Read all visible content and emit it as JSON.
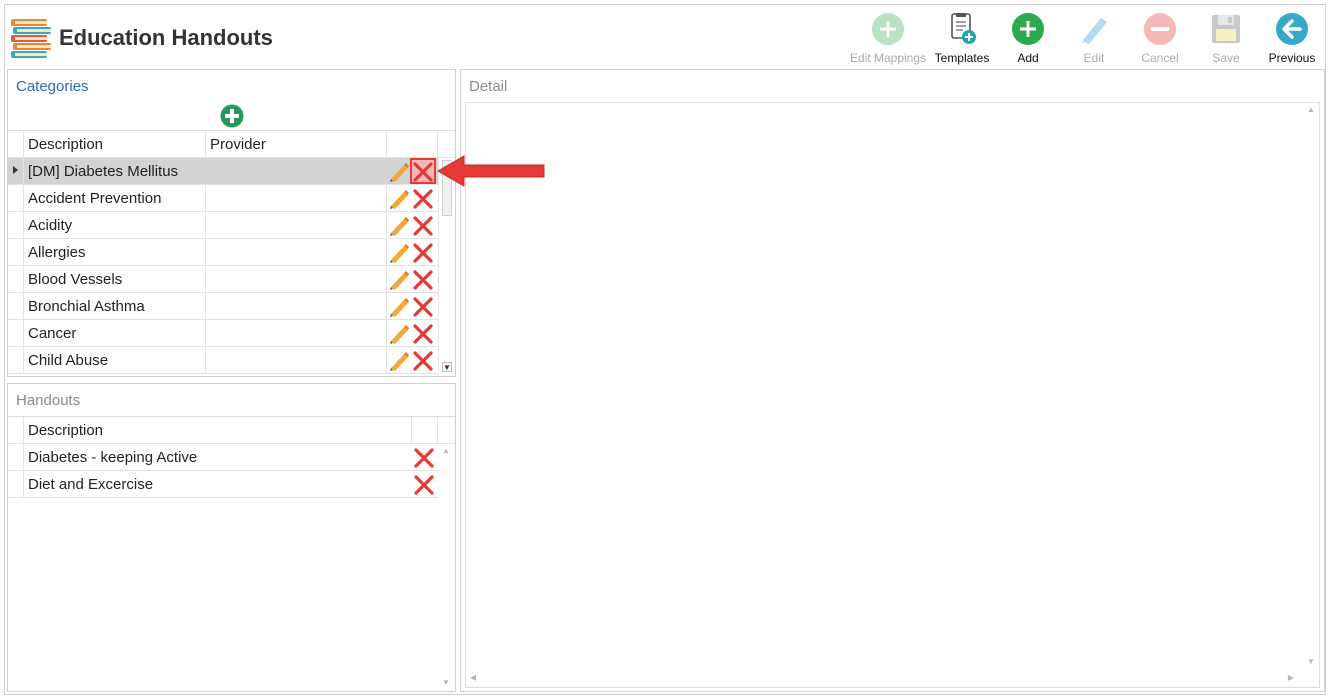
{
  "app": {
    "title": "Education Handouts",
    "logo_icon": "books-icon"
  },
  "toolbar": {
    "buttons": [
      {
        "label": "Edit Mappings",
        "icon": "plus-circle-icon",
        "enabled": false
      },
      {
        "label": "Templates",
        "icon": "document-add-icon",
        "enabled": true
      },
      {
        "label": "Add",
        "icon": "plus-circle-icon",
        "enabled": true
      },
      {
        "label": "Edit",
        "icon": "pencil-icon",
        "enabled": false
      },
      {
        "label": "Cancel",
        "icon": "minus-circle-icon",
        "enabled": false
      },
      {
        "label": "Save",
        "icon": "floppy-disk-icon",
        "enabled": false
      },
      {
        "label": "Previous",
        "icon": "arrow-left-circle-icon",
        "enabled": true
      }
    ]
  },
  "categories": {
    "title": "Categories",
    "add_icon": "add-category-icon",
    "columns": [
      "Description",
      "Provider"
    ],
    "rows": [
      {
        "description": "[DM] Diabetes Mellitus",
        "provider": "",
        "selected": true
      },
      {
        "description": "Accident Prevention",
        "provider": "",
        "selected": false
      },
      {
        "description": "Acidity",
        "provider": "",
        "selected": false
      },
      {
        "description": "Allergies",
        "provider": "",
        "selected": false
      },
      {
        "description": "Blood Vessels",
        "provider": "",
        "selected": false
      },
      {
        "description": "Bronchial Asthma",
        "provider": "",
        "selected": false
      },
      {
        "description": "Cancer",
        "provider": "",
        "selected": false
      },
      {
        "description": "Child Abuse",
        "provider": "",
        "selected": false
      }
    ]
  },
  "handouts": {
    "title": "Handouts",
    "columns": [
      "Description"
    ],
    "rows": [
      {
        "description": "Diabetes - keeping Active"
      },
      {
        "description": "Diet and Excercise"
      }
    ]
  },
  "detail": {
    "title": "Detail"
  },
  "colors": {
    "accent_blue": "#2a6eb5",
    "add_green": "#2ea84f",
    "delete_red": "#e53935",
    "selected_row": "#d3d3d3",
    "callout_red": "#e53935"
  }
}
